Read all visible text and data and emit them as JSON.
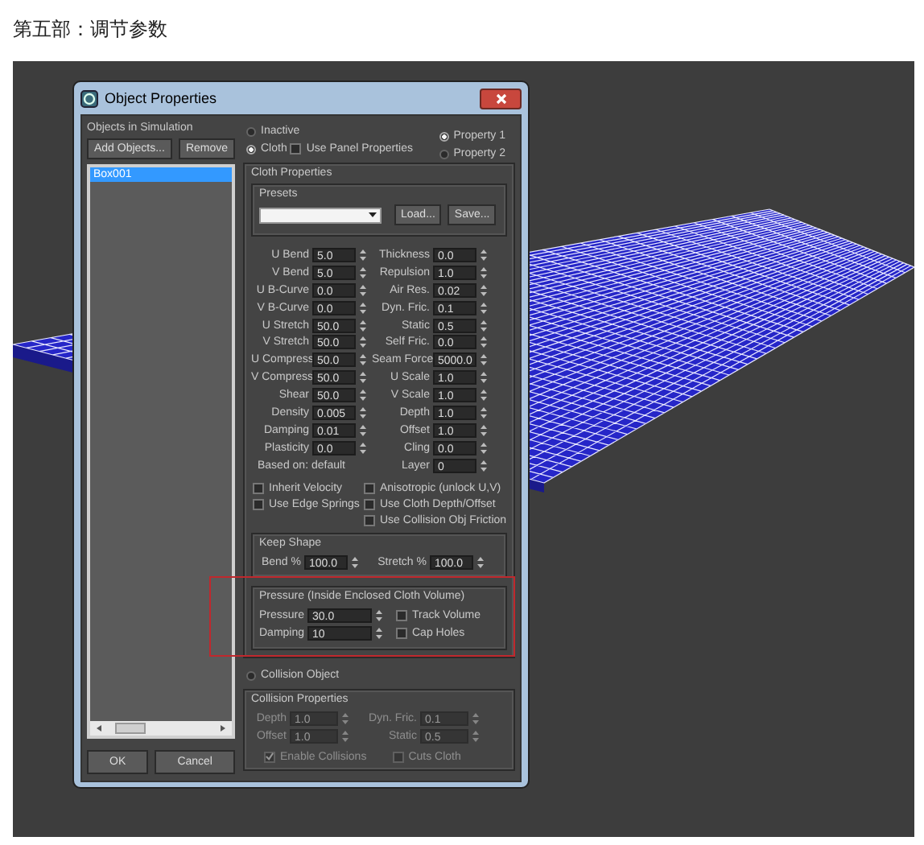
{
  "heading": "第五部：调节参数",
  "dialog": {
    "title": "Object Properties",
    "objects_label": "Objects in Simulation",
    "top_buttons": [
      "Add Objects...",
      "Remove"
    ],
    "objects": [
      {
        "name": "Box001",
        "selected": true
      }
    ],
    "bottom_buttons": [
      "OK",
      "Cancel"
    ],
    "mode_radios": [
      {
        "label": "Inactive",
        "selected": false
      },
      {
        "label": "Cloth",
        "selected": true
      }
    ],
    "use_panel_properties": {
      "label": "Use Panel Properties",
      "checked": false
    },
    "property_radios": [
      {
        "label": "Property 1",
        "selected": true
      },
      {
        "label": "Property 2",
        "selected": false
      }
    ],
    "cloth_properties": {
      "title": "Cloth Properties",
      "presets": {
        "title": "Presets",
        "buttons": [
          "Load...",
          "Save..."
        ]
      },
      "left_params": [
        {
          "label": "U Bend",
          "value": "5.0"
        },
        {
          "label": "V Bend",
          "value": "5.0"
        },
        {
          "label": "U B-Curve",
          "value": "0.0"
        },
        {
          "label": "V B-Curve",
          "value": "0.0"
        },
        {
          "label": "U Stretch",
          "value": "50.0"
        },
        {
          "label": "V Stretch",
          "value": "50.0"
        },
        {
          "label": "U Compress",
          "value": "50.0"
        },
        {
          "label": "V Compress",
          "value": "50.0"
        },
        {
          "label": "Shear",
          "value": "50.0"
        },
        {
          "label": "Density",
          "value": "0.005"
        },
        {
          "label": "Damping",
          "value": "0.01"
        },
        {
          "label": "Plasticity",
          "value": "0.0"
        }
      ],
      "based_on": "Based on: default",
      "right_params": [
        {
          "label": "Thickness",
          "value": "0.0"
        },
        {
          "label": "Repulsion",
          "value": "1.0"
        },
        {
          "label": "Air Res.",
          "value": "0.02"
        },
        {
          "label": "Dyn. Fric.",
          "value": "0.1"
        },
        {
          "label": "Static",
          "value": "0.5"
        },
        {
          "label": "Self Fric.",
          "value": "0.0"
        },
        {
          "label": "Seam Force",
          "value": "5000.0"
        },
        {
          "label": "U Scale",
          "value": "1.0"
        },
        {
          "label": "V Scale",
          "value": "1.0"
        },
        {
          "label": "Depth",
          "value": "1.0"
        },
        {
          "label": "Offset",
          "value": "1.0"
        },
        {
          "label": "Cling",
          "value": "0.0"
        },
        {
          "label": "Layer",
          "value": "0"
        }
      ],
      "checkboxes_left": [
        {
          "label": "Inherit Velocity",
          "checked": false
        },
        {
          "label": "Use Edge Springs",
          "checked": false
        }
      ],
      "checkboxes_right": [
        {
          "label": "Anisotropic (unlock U,V)",
          "checked": false
        },
        {
          "label": "Use Cloth Depth/Offset",
          "checked": false
        },
        {
          "label": "Use Collision Obj Friction",
          "checked": false
        }
      ],
      "keep_shape": {
        "title": "Keep Shape",
        "params": [
          {
            "label": "Bend %",
            "value": "100.0"
          },
          {
            "label": "Stretch %",
            "value": "100.0"
          }
        ]
      },
      "pressure": {
        "title": "Pressure (Inside Enclosed Cloth Volume)",
        "params": [
          {
            "label": "Pressure",
            "value": "30.0"
          },
          {
            "label": "Damping",
            "value": "10"
          }
        ],
        "checkboxes": [
          {
            "label": "Track Volume",
            "checked": false
          },
          {
            "label": "Cap Holes",
            "checked": false
          }
        ]
      }
    },
    "collision_radio": {
      "label": "Collision Object",
      "selected": false
    },
    "collision_properties": {
      "title": "Collision Properties",
      "params": [
        {
          "label": "Depth",
          "value": "1.0",
          "disabled": true
        },
        {
          "label": "Offset",
          "value": "1.0",
          "disabled": true
        },
        {
          "label": "Dyn. Fric.",
          "value": "0.1",
          "disabled": true
        },
        {
          "label": "Static",
          "value": "0.5",
          "disabled": true
        }
      ],
      "checkboxes": [
        {
          "label": "Enable Collisions",
          "checked": true,
          "disabled": true
        },
        {
          "label": "Cuts Cloth",
          "checked": false,
          "disabled": true
        }
      ]
    }
  }
}
